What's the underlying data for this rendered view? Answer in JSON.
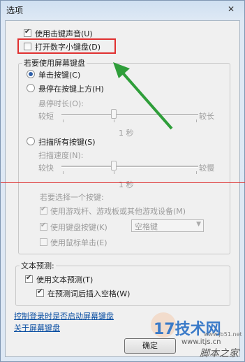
{
  "window": {
    "title": "选项"
  },
  "options": {
    "key_sound": {
      "label": "使用击键声音(U)",
      "checked": true
    },
    "numpad": {
      "label": "打开数字小键盘(D)",
      "checked": false
    }
  },
  "screen_keyboard": {
    "group_title": "若要使用屏幕键盘",
    "click_keys": {
      "label": "单击按键(C)",
      "selected": true
    },
    "hover_keys": {
      "label": "悬停在按键上方(H)",
      "selected": false
    },
    "hover_duration": {
      "label": "悬停时长(O):",
      "min_label": "较短",
      "max_label": "较长",
      "value_label": "1 秒"
    },
    "scan_keys": {
      "label": "扫描所有按键(S)",
      "selected": false
    },
    "scan_speed": {
      "label": "扫描速度(N):",
      "min_label": "较快",
      "max_label": "较慢",
      "value_label": "1 秒"
    },
    "select_prompt": "若要选择一个按键:",
    "joystick": {
      "label": "使用游戏杆、游戏板或其他游戏设备(M)",
      "checked": true
    },
    "keyboard_key": {
      "label": "使用键盘按键(K)",
      "checked": true,
      "select_value": "空格键"
    },
    "mouse_click": {
      "label": "使用鼠标单击(E)",
      "checked": false
    }
  },
  "text_prediction": {
    "group_title": "文本预测:",
    "use": {
      "label": "使用文本预测(T)",
      "checked": true
    },
    "space": {
      "label": "在预测词后插入空格(W)",
      "checked": true
    }
  },
  "links": {
    "login_control": "控制登录时是否启动屏幕键盘",
    "about": "关于屏幕键盘"
  },
  "buttons": {
    "ok": "确定"
  },
  "watermark": {
    "brand": "17技术网",
    "url": "www.itjs.cn",
    "site": "脚本之家",
    "site_url": "www.jb51.net"
  }
}
